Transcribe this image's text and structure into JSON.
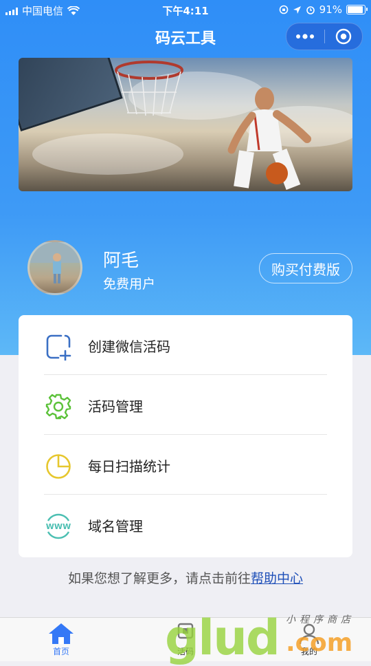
{
  "status_bar": {
    "carrier": "中国电信",
    "time": "下午4:11",
    "battery": "91%",
    "battery_level": 0.91
  },
  "navbar": {
    "title": "码云工具",
    "more_icon": "more-dots-icon",
    "close_icon": "target-circle-icon"
  },
  "banner": {
    "link_icon": "link-icon"
  },
  "profile": {
    "name": "阿毛",
    "plan": "免费用户",
    "buy_label": "购买付费版"
  },
  "menu": {
    "items": [
      {
        "label": "创建微信活码",
        "icon": "add-square-icon",
        "color": "#3a6fc4"
      },
      {
        "label": "活码管理",
        "icon": "gear-icon",
        "color": "#5cc23a"
      },
      {
        "label": "每日扫描统计",
        "icon": "pie-chart-icon",
        "color": "#e6c72e"
      },
      {
        "label": "域名管理",
        "icon": "www-icon",
        "color": "#4cbfb2"
      }
    ]
  },
  "help": {
    "text": "如果您想了解更多，请点击前往",
    "link": "帮助中心"
  },
  "tabbar": {
    "tabs": [
      {
        "label": "首页",
        "icon": "home-icon",
        "active": true
      },
      {
        "label": "活码",
        "icon": "qrcode-icon",
        "active": false
      },
      {
        "label": "我的",
        "icon": "user-icon",
        "active": false
      }
    ]
  },
  "watermark": {
    "brand": "glud",
    "suffix": ".com",
    "tagline": "小程序商店"
  },
  "colors": {
    "primary": "#3478f6",
    "header_gradient_top": "#2f8ef7",
    "header_gradient_bottom": "#5db8f7",
    "link": "#1e4fb8"
  }
}
